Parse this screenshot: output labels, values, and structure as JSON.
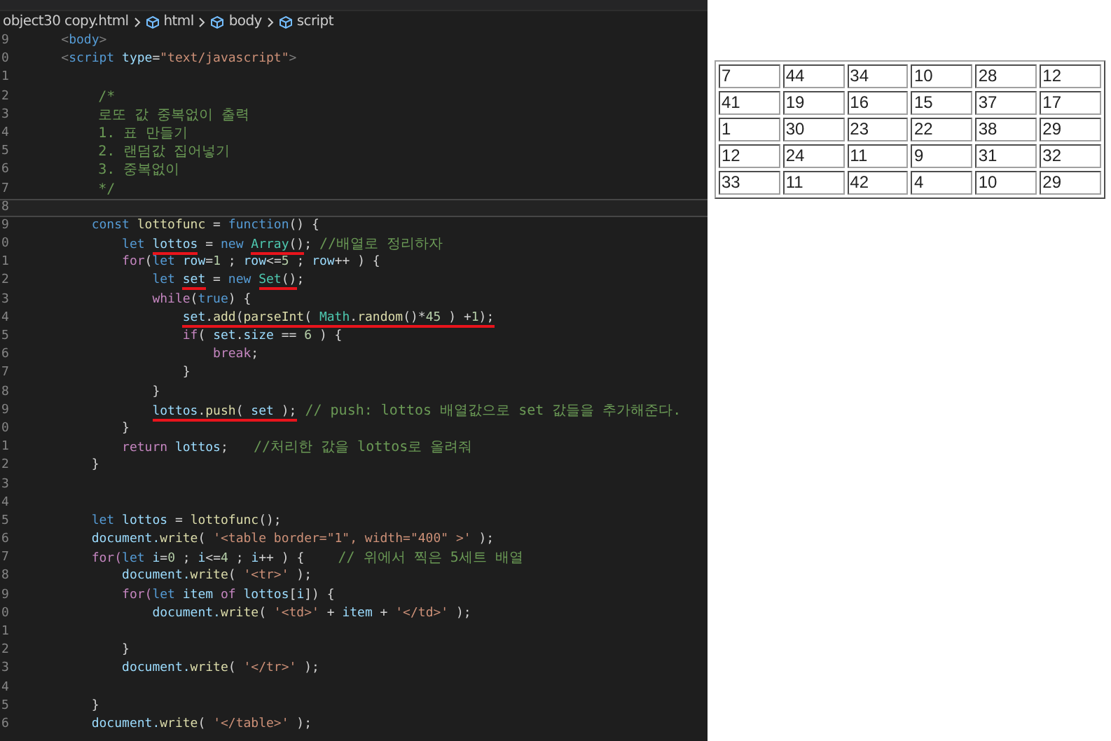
{
  "breadcrumb": [
    {
      "kind": "file",
      "label": "object30 copy.html"
    },
    {
      "kind": "symbol",
      "label": "html"
    },
    {
      "kind": "symbol",
      "label": "body"
    },
    {
      "kind": "symbol",
      "label": "script"
    }
  ],
  "editor": {
    "lines": [
      {
        "number": "9",
        "current": false,
        "tokens": [
          {
            "kind": "punct",
            "text": "    <"
          },
          {
            "kind": "tag",
            "text": "body"
          },
          {
            "kind": "punct",
            "text": ">"
          }
        ]
      },
      {
        "number": "0",
        "current": false,
        "tokens": [
          {
            "kind": "punct",
            "text": "    <"
          },
          {
            "kind": "tag",
            "text": "script"
          },
          {
            "kind": "attr",
            "text": " type"
          },
          {
            "kind": "plain",
            "text": "="
          },
          {
            "kind": "string",
            "text": "\"text/javascript\""
          },
          {
            "kind": "punct",
            "text": ">"
          }
        ]
      },
      {
        "number": "1",
        "current": false
      },
      {
        "number": "2",
        "current": false,
        "tokens": [
          {
            "kind": "comment",
            "text": "        /*"
          }
        ]
      },
      {
        "number": "3",
        "current": false,
        "tokens": [
          {
            "kind": "comment",
            "text": "        로또 값 중복없이 출력"
          }
        ]
      },
      {
        "number": "4",
        "current": false,
        "tokens": [
          {
            "kind": "comment",
            "text": "        1. 표 만들기"
          }
        ]
      },
      {
        "number": "5",
        "current": false,
        "tokens": [
          {
            "kind": "comment",
            "text": "        2. 랜덤값 집어넣기"
          }
        ]
      },
      {
        "number": "6",
        "current": false,
        "tokens": [
          {
            "kind": "comment",
            "text": "        3. 중복없이"
          }
        ]
      },
      {
        "number": "7",
        "current": false,
        "tokens": [
          {
            "kind": "comment",
            "text": "        */"
          }
        ]
      },
      {
        "number": "8",
        "current": true
      },
      {
        "number": "9",
        "current": false,
        "tokens": [
          {
            "kind": "keyword",
            "text": "        const"
          },
          {
            "kind": "fn",
            "text": " lottofunc"
          },
          {
            "kind": "plain",
            "text": " = "
          },
          {
            "kind": "keyword",
            "text": "function"
          },
          {
            "kind": "plain",
            "text": "() {"
          }
        ]
      },
      {
        "number": "0",
        "current": false,
        "tokens": [
          {
            "kind": "keyword",
            "text": "            let "
          },
          {
            "kind": "underline",
            "tokens": [
              {
                "kind": "var",
                "text": "lottos"
              }
            ]
          },
          {
            "kind": "plain",
            "text": " = "
          },
          {
            "kind": "keyword",
            "text": "new "
          },
          {
            "kind": "underline",
            "tokens": [
              {
                "kind": "class",
                "text": "Array"
              },
              {
                "kind": "plain",
                "text": "()"
              }
            ]
          },
          {
            "kind": "plain",
            "text": "; "
          },
          {
            "kind": "comment",
            "text": "//배열로 정리하자"
          }
        ]
      },
      {
        "number": "1",
        "current": false,
        "tokens": [
          {
            "kind": "control",
            "text": "            for"
          },
          {
            "kind": "plain",
            "text": "("
          },
          {
            "kind": "keyword",
            "text": "let"
          },
          {
            "kind": "var",
            "text": " row"
          },
          {
            "kind": "plain",
            "text": "="
          },
          {
            "kind": "number",
            "text": "1"
          },
          {
            "kind": "plain",
            "text": " ; "
          },
          {
            "kind": "var",
            "text": "row"
          },
          {
            "kind": "plain",
            "text": "<="
          },
          {
            "kind": "number",
            "text": "5"
          },
          {
            "kind": "plain",
            "text": " ; "
          },
          {
            "kind": "var",
            "text": "row"
          },
          {
            "kind": "plain",
            "text": "++ ) {"
          }
        ]
      },
      {
        "number": "2",
        "current": false,
        "tokens": [
          {
            "kind": "keyword",
            "text": "                let "
          },
          {
            "kind": "underline",
            "tokens": [
              {
                "kind": "var",
                "text": "set"
              }
            ]
          },
          {
            "kind": "plain",
            "text": " = "
          },
          {
            "kind": "keyword",
            "text": "new "
          },
          {
            "kind": "underline",
            "tokens": [
              {
                "kind": "class",
                "text": "Set"
              },
              {
                "kind": "plain",
                "text": "()"
              }
            ]
          },
          {
            "kind": "plain",
            "text": ";"
          }
        ]
      },
      {
        "number": "3",
        "current": false,
        "tokens": [
          {
            "kind": "control",
            "text": "                while"
          },
          {
            "kind": "plain",
            "text": "("
          },
          {
            "kind": "keyword",
            "text": "true"
          },
          {
            "kind": "plain",
            "text": ") {"
          }
        ]
      },
      {
        "number": "4",
        "current": false,
        "tokens": [
          {
            "kind": "underline",
            "tokens": [
              {
                "kind": "var",
                "text": "                    set"
              },
              {
                "kind": "plain",
                "text": "."
              },
              {
                "kind": "fn",
                "text": "add"
              },
              {
                "kind": "plain",
                "text": "("
              },
              {
                "kind": "fn",
                "text": "parseInt"
              },
              {
                "kind": "plain",
                "text": "( "
              },
              {
                "kind": "class",
                "text": "Math"
              },
              {
                "kind": "plain",
                "text": "."
              },
              {
                "kind": "fn",
                "text": "random"
              },
              {
                "kind": "plain",
                "text": "()*"
              },
              {
                "kind": "number",
                "text": "45"
              },
              {
                "kind": "plain",
                "text": " ) +"
              },
              {
                "kind": "number",
                "text": "1"
              },
              {
                "kind": "plain",
                "text": ");"
              }
            ]
          }
        ]
      },
      {
        "number": "5",
        "current": false,
        "tokens": [
          {
            "kind": "control",
            "text": "                    if"
          },
          {
            "kind": "plain",
            "text": "( "
          },
          {
            "kind": "var",
            "text": "set"
          },
          {
            "kind": "plain",
            "text": "."
          },
          {
            "kind": "var",
            "text": "size"
          },
          {
            "kind": "plain",
            "text": " == "
          },
          {
            "kind": "number",
            "text": "6"
          },
          {
            "kind": "plain",
            "text": " ) {"
          }
        ]
      },
      {
        "number": "6",
        "current": false,
        "tokens": [
          {
            "kind": "control",
            "text": "                        break"
          },
          {
            "kind": "plain",
            "text": ";"
          }
        ]
      },
      {
        "number": "7",
        "current": false,
        "tokens": [
          {
            "kind": "plain",
            "text": "                    }"
          }
        ]
      },
      {
        "number": "8",
        "current": false,
        "tokens": [
          {
            "kind": "plain",
            "text": "                }"
          }
        ]
      },
      {
        "number": "9",
        "current": false,
        "tokens": [
          {
            "kind": "underline",
            "tokens": [
              {
                "kind": "var",
                "text": "                lottos"
              },
              {
                "kind": "plain",
                "text": "."
              },
              {
                "kind": "fn",
                "text": "push"
              },
              {
                "kind": "plain",
                "text": "( "
              },
              {
                "kind": "var",
                "text": "set"
              },
              {
                "kind": "plain",
                "text": " );"
              }
            ]
          },
          {
            "kind": "comment",
            "text": " // push: lottos 배열값으로 set 값들을 추가해준다."
          }
        ]
      },
      {
        "number": "0",
        "current": false,
        "tokens": [
          {
            "kind": "plain",
            "text": "            }"
          }
        ]
      },
      {
        "number": "1",
        "current": false,
        "tokens": [
          {
            "kind": "control",
            "text": "            return"
          },
          {
            "kind": "var",
            "text": " lottos"
          },
          {
            "kind": "plain",
            "text": ";"
          },
          {
            "kind": "comment",
            "text": "   //처리한 값을 lottos로 올려줘"
          }
        ]
      },
      {
        "number": "2",
        "current": false,
        "tokens": [
          {
            "kind": "plain",
            "text": "        }"
          }
        ]
      },
      {
        "number": "3",
        "current": false
      },
      {
        "number": "4",
        "current": false
      },
      {
        "number": "5",
        "current": false,
        "tokens": [
          {
            "kind": "keyword",
            "text": "        let"
          },
          {
            "kind": "var",
            "text": " lottos"
          },
          {
            "kind": "plain",
            "text": " = "
          },
          {
            "kind": "fn",
            "text": "lottofunc"
          },
          {
            "kind": "plain",
            "text": "();"
          }
        ]
      },
      {
        "number": "6",
        "current": false,
        "tokens": [
          {
            "kind": "var",
            "text": "        document."
          },
          {
            "kind": "fn",
            "text": "write"
          },
          {
            "kind": "plain",
            "text": "( "
          },
          {
            "kind": "string",
            "text": "'<table border=\"1\", width=\"400\" >'"
          },
          {
            "kind": "plain",
            "text": " );"
          }
        ]
      },
      {
        "number": "7",
        "current": false,
        "tokens": [
          {
            "kind": "control",
            "text": "        for("
          },
          {
            "kind": "keyword",
            "text": "let"
          },
          {
            "kind": "var",
            "text": " i"
          },
          {
            "kind": "plain",
            "text": "="
          },
          {
            "kind": "number",
            "text": "0"
          },
          {
            "kind": "plain",
            "text": " ; "
          },
          {
            "kind": "var",
            "text": "i"
          },
          {
            "kind": "plain",
            "text": "<="
          },
          {
            "kind": "number",
            "text": "4"
          },
          {
            "kind": "plain",
            "text": " ; "
          },
          {
            "kind": "var",
            "text": "i"
          },
          {
            "kind": "plain",
            "text": "++ ) {"
          },
          {
            "kind": "comment",
            "text": "    // 위에서 찍은 5세트 배열"
          }
        ]
      },
      {
        "number": "8",
        "current": false,
        "tokens": [
          {
            "kind": "var",
            "text": "            document."
          },
          {
            "kind": "fn",
            "text": "write"
          },
          {
            "kind": "plain",
            "text": "( "
          },
          {
            "kind": "string",
            "text": "'<tr>'"
          },
          {
            "kind": "plain",
            "text": " );"
          }
        ]
      },
      {
        "number": "9",
        "current": false,
        "tokens": [
          {
            "kind": "control",
            "text": "            for("
          },
          {
            "kind": "keyword",
            "text": "let"
          },
          {
            "kind": "var",
            "text": " item"
          },
          {
            "kind": "control",
            "text": " of"
          },
          {
            "kind": "var",
            "text": " lottos"
          },
          {
            "kind": "plain",
            "text": "["
          },
          {
            "kind": "var",
            "text": "i"
          },
          {
            "kind": "plain",
            "text": "]) {"
          }
        ]
      },
      {
        "number": "0",
        "current": false,
        "tokens": [
          {
            "kind": "var",
            "text": "                document."
          },
          {
            "kind": "fn",
            "text": "write"
          },
          {
            "kind": "plain",
            "text": "( "
          },
          {
            "kind": "string",
            "text": "'<td>'"
          },
          {
            "kind": "plain",
            "text": " + "
          },
          {
            "kind": "var",
            "text": "item"
          },
          {
            "kind": "plain",
            "text": " + "
          },
          {
            "kind": "string",
            "text": "'</td>'"
          },
          {
            "kind": "plain",
            "text": " );"
          }
        ]
      },
      {
        "number": "1",
        "current": false
      },
      {
        "number": "2",
        "current": false,
        "tokens": [
          {
            "kind": "plain",
            "text": "            }"
          }
        ]
      },
      {
        "number": "3",
        "current": false,
        "tokens": [
          {
            "kind": "var",
            "text": "            document."
          },
          {
            "kind": "fn",
            "text": "write"
          },
          {
            "kind": "plain",
            "text": "( "
          },
          {
            "kind": "string",
            "text": "'</tr>'"
          },
          {
            "kind": "plain",
            "text": " );"
          }
        ]
      },
      {
        "number": "4",
        "current": false
      },
      {
        "number": "5",
        "current": false,
        "tokens": [
          {
            "kind": "plain",
            "text": "        }"
          }
        ]
      },
      {
        "number": "6",
        "current": false,
        "tokens": [
          {
            "kind": "var",
            "text": "        document."
          },
          {
            "kind": "fn",
            "text": "write"
          },
          {
            "kind": "plain",
            "text": "( "
          },
          {
            "kind": "string",
            "text": "'</table>'"
          },
          {
            "kind": "plain",
            "text": " );"
          }
        ]
      }
    ]
  },
  "preview": {
    "table": {
      "rows": [
        [
          "7",
          "44",
          "34",
          "10",
          "28",
          "12"
        ],
        [
          "41",
          "19",
          "16",
          "15",
          "37",
          "17"
        ],
        [
          "1",
          "30",
          "23",
          "22",
          "38",
          "29"
        ],
        [
          "12",
          "24",
          "11",
          "9",
          "31",
          "32"
        ],
        [
          "33",
          "11",
          "42",
          "4",
          "10",
          "29"
        ]
      ]
    }
  }
}
